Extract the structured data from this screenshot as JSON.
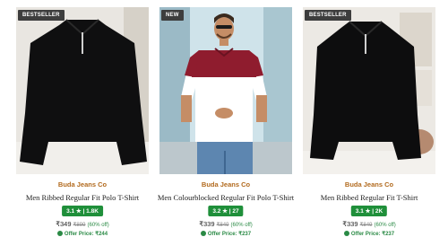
{
  "products": [
    {
      "badge": "BESTSELLER",
      "brand": "Buda Jeans Co",
      "title": "Men Ribbed Regular Fit Polo T-Shirt",
      "rating": "3.1 ★ | 1.8K",
      "price": "₹349",
      "mrp": "₹899",
      "discount": "(60% off)",
      "offer_label": "Offer Price: ₹244",
      "rating_color": "#1f8f3a"
    },
    {
      "badge": "NEW",
      "brand": "Buda Jeans Co",
      "title": "Men Colourblocked Regular Fit Polo T-Shirt",
      "rating": "3.2 ★ | 27",
      "price": "₹339",
      "mrp": "₹849",
      "discount": "(60% off)",
      "offer_label": "Offer Price: ₹237",
      "rating_color": "#1f8f3a"
    },
    {
      "badge": "BESTSELLER",
      "brand": "Buda Jeans Co",
      "title": "Men Ribbed Regular Fit T-Shirt",
      "rating": "3.1 ★ | 2K",
      "price": "₹339",
      "mrp": "₹849",
      "discount": "(60% off)",
      "offer_label": "Offer Price: ₹237",
      "rating_color": "#1f8f3a"
    }
  ]
}
